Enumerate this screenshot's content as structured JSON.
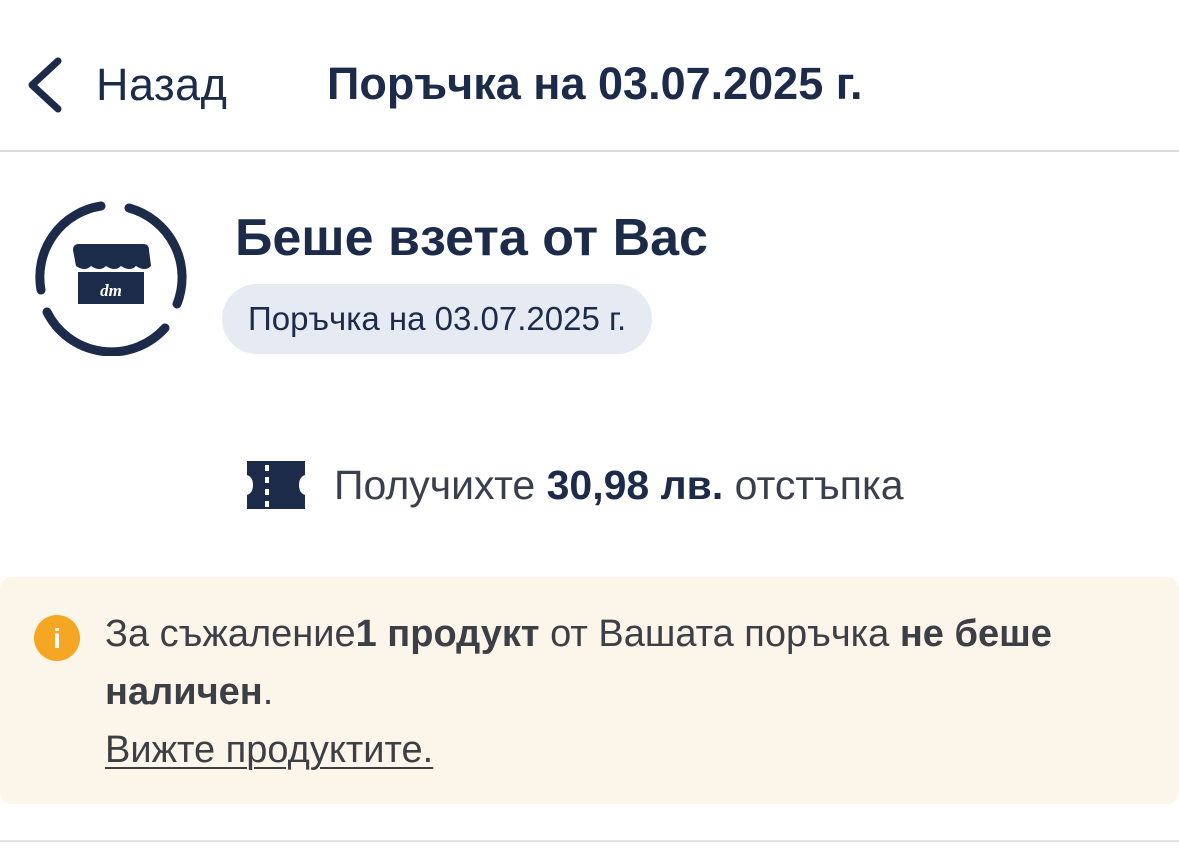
{
  "header": {
    "back_label": "Назад",
    "title": "Поръчка на 03.07.2025 г."
  },
  "status": {
    "icon": "store-pickup-icon",
    "store_logo_text": "dm",
    "title": "Беше взета от Вас",
    "order_chip": "Поръчка на 03.07.2025 г."
  },
  "discount": {
    "icon": "coupon-icon",
    "prefix": "Получихте ",
    "amount": "30,98 лв.",
    "suffix": " отстъпка"
  },
  "notice": {
    "icon": "info-icon",
    "info_glyph": "i",
    "part1": "За съжаление",
    "bold1": "1 продукт",
    "part2": " от Вашата поръчка ",
    "bold2": "не беше наличен",
    "part3": ".",
    "link": "Вижте продуктите."
  },
  "colors": {
    "navy": "#1c2b4a",
    "chip_bg": "#e6ebf3",
    "notice_bg": "#fcf5ea",
    "info_orange": "#f5a623"
  }
}
